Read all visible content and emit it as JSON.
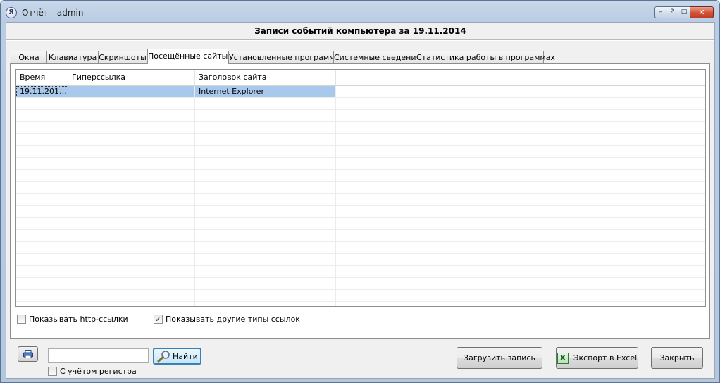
{
  "window": {
    "title": "Отчёт - admin",
    "icon": "app-logo-icon",
    "controls": {
      "minimize": "–",
      "help": "?",
      "maximize": "□",
      "close": "✕"
    }
  },
  "header": {
    "title": "Записи событий компьютера за 19.11.2014"
  },
  "tabs": [
    {
      "label": "Окна"
    },
    {
      "label": "Клавиатура"
    },
    {
      "label": "Скриншоты"
    },
    {
      "label": "Посещённые сайты",
      "active": true
    },
    {
      "label": "Установленные программы"
    },
    {
      "label": "Системные сведения"
    },
    {
      "label": "Статистика работы в программах"
    }
  ],
  "table": {
    "columns": [
      "Время",
      "Гиперссылка",
      "Заголовок сайта"
    ],
    "rows": [
      {
        "time": "19.11.201…",
        "link": "",
        "title": "Internet Explorer",
        "selected": true
      }
    ]
  },
  "options": {
    "show_http": {
      "label": "Показывать http-ссылки",
      "checked": false
    },
    "show_other": {
      "label": "Показывать другие типы ссылок",
      "checked": true
    }
  },
  "search": {
    "value": "",
    "find_label": "Найти",
    "case_label": "С учётом регистра",
    "case_checked": false
  },
  "buttons": {
    "load": "Загрузить запись",
    "export": "Экспорт в Excel",
    "close": "Закрыть"
  },
  "colors": {
    "selection": "#a8c8ec",
    "frame": "#b8cce3"
  }
}
